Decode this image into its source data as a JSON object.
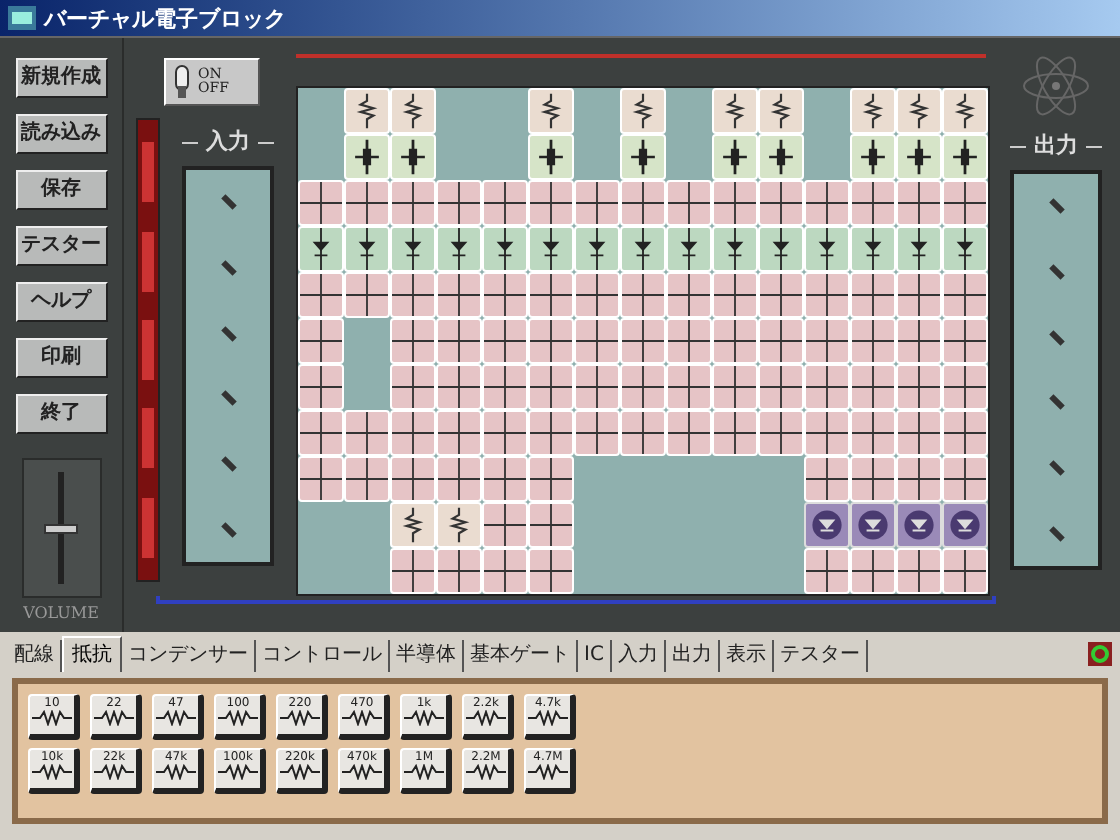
{
  "window": {
    "title": "バーチャル電子ブロック"
  },
  "toolbar": [
    {
      "label": "新規作成"
    },
    {
      "label": "読み込み"
    },
    {
      "label": "保存"
    },
    {
      "label": "テスター"
    },
    {
      "label": "ヘルプ"
    },
    {
      "label": "印刷"
    },
    {
      "label": "終了"
    }
  ],
  "volume": {
    "label": "VOLUME",
    "level": 0.5
  },
  "power_switch": {
    "on_label": "ON",
    "off_label": "OFF",
    "on": false
  },
  "input_panel": {
    "label": "入力"
  },
  "output_panel": {
    "label": "出力"
  },
  "board": {
    "rows": [
      [
        {
          "kind": "empty"
        },
        {
          "kind": "resistor"
        },
        {
          "kind": "resistor"
        },
        {
          "kind": "empty"
        },
        {
          "kind": "empty"
        },
        {
          "kind": "resistor"
        },
        {
          "kind": "empty"
        },
        {
          "kind": "resistor"
        },
        {
          "kind": "empty"
        },
        {
          "kind": "resistor"
        },
        {
          "kind": "resistor"
        },
        {
          "kind": "empty"
        },
        {
          "kind": "resistor"
        },
        {
          "kind": "resistor"
        },
        {
          "kind": "resistor"
        }
      ],
      [
        {
          "kind": "empty"
        },
        {
          "kind": "capacitor"
        },
        {
          "kind": "capacitor"
        },
        {
          "kind": "empty"
        },
        {
          "kind": "empty"
        },
        {
          "kind": "capacitor"
        },
        {
          "kind": "empty"
        },
        {
          "kind": "capacitor"
        },
        {
          "kind": "empty"
        },
        {
          "kind": "capacitor"
        },
        {
          "kind": "capacitor"
        },
        {
          "kind": "empty"
        },
        {
          "kind": "capacitor"
        },
        {
          "kind": "capacitor"
        },
        {
          "kind": "capacitor"
        }
      ],
      [
        {
          "kind": "wire"
        },
        {
          "kind": "wire"
        },
        {
          "kind": "wire"
        },
        {
          "kind": "wire"
        },
        {
          "kind": "wire"
        },
        {
          "kind": "wire"
        },
        {
          "kind": "wire"
        },
        {
          "kind": "wire"
        },
        {
          "kind": "wire"
        },
        {
          "kind": "wire"
        },
        {
          "kind": "wire"
        },
        {
          "kind": "wire"
        },
        {
          "kind": "wire"
        },
        {
          "kind": "wire"
        },
        {
          "kind": "wire"
        }
      ],
      [
        {
          "kind": "diode"
        },
        {
          "kind": "diode"
        },
        {
          "kind": "diode"
        },
        {
          "kind": "diode"
        },
        {
          "kind": "diode"
        },
        {
          "kind": "diode"
        },
        {
          "kind": "diode"
        },
        {
          "kind": "diode"
        },
        {
          "kind": "diode"
        },
        {
          "kind": "diode"
        },
        {
          "kind": "diode"
        },
        {
          "kind": "diode"
        },
        {
          "kind": "diode"
        },
        {
          "kind": "diode"
        },
        {
          "kind": "diode"
        }
      ],
      [
        {
          "kind": "wire"
        },
        {
          "kind": "wire"
        },
        {
          "kind": "wire"
        },
        {
          "kind": "wire"
        },
        {
          "kind": "wire"
        },
        {
          "kind": "wire"
        },
        {
          "kind": "wire"
        },
        {
          "kind": "wire"
        },
        {
          "kind": "wire"
        },
        {
          "kind": "wire"
        },
        {
          "kind": "wire"
        },
        {
          "kind": "wire"
        },
        {
          "kind": "wire"
        },
        {
          "kind": "wire"
        },
        {
          "kind": "wire"
        }
      ],
      [
        {
          "kind": "wire"
        },
        {
          "kind": "empty"
        },
        {
          "kind": "wire"
        },
        {
          "kind": "wire"
        },
        {
          "kind": "wire"
        },
        {
          "kind": "wire"
        },
        {
          "kind": "wire"
        },
        {
          "kind": "wire"
        },
        {
          "kind": "wire"
        },
        {
          "kind": "wire"
        },
        {
          "kind": "wire"
        },
        {
          "kind": "wire"
        },
        {
          "kind": "wire"
        },
        {
          "kind": "wire"
        },
        {
          "kind": "wire"
        }
      ],
      [
        {
          "kind": "wire"
        },
        {
          "kind": "empty"
        },
        {
          "kind": "wire"
        },
        {
          "kind": "wire"
        },
        {
          "kind": "wire"
        },
        {
          "kind": "wire"
        },
        {
          "kind": "wire"
        },
        {
          "kind": "wire"
        },
        {
          "kind": "wire"
        },
        {
          "kind": "wire"
        },
        {
          "kind": "wire"
        },
        {
          "kind": "wire"
        },
        {
          "kind": "wire"
        },
        {
          "kind": "wire"
        },
        {
          "kind": "wire"
        }
      ],
      [
        {
          "kind": "wire"
        },
        {
          "kind": "wire"
        },
        {
          "kind": "wire"
        },
        {
          "kind": "wire"
        },
        {
          "kind": "wire"
        },
        {
          "kind": "wire"
        },
        {
          "kind": "wire"
        },
        {
          "kind": "wire"
        },
        {
          "kind": "wire"
        },
        {
          "kind": "wire"
        },
        {
          "kind": "wire"
        },
        {
          "kind": "wire"
        },
        {
          "kind": "wire"
        },
        {
          "kind": "wire"
        },
        {
          "kind": "wire"
        }
      ],
      [
        {
          "kind": "wire"
        },
        {
          "kind": "wire"
        },
        {
          "kind": "wire"
        },
        {
          "kind": "wire"
        },
        {
          "kind": "wire"
        },
        {
          "kind": "wire"
        },
        {
          "kind": "empty"
        },
        {
          "kind": "empty"
        },
        {
          "kind": "empty"
        },
        {
          "kind": "empty"
        },
        {
          "kind": "empty"
        },
        {
          "kind": "wire"
        },
        {
          "kind": "wire"
        },
        {
          "kind": "wire"
        },
        {
          "kind": "wire"
        }
      ],
      [
        {
          "kind": "empty"
        },
        {
          "kind": "empty"
        },
        {
          "kind": "resistor"
        },
        {
          "kind": "resistor"
        },
        {
          "kind": "wire"
        },
        {
          "kind": "wire"
        },
        {
          "kind": "empty"
        },
        {
          "kind": "empty"
        },
        {
          "kind": "empty"
        },
        {
          "kind": "empty"
        },
        {
          "kind": "empty"
        },
        {
          "kind": "led"
        },
        {
          "kind": "led"
        },
        {
          "kind": "led"
        },
        {
          "kind": "led"
        }
      ],
      [
        {
          "kind": "empty"
        },
        {
          "kind": "empty"
        },
        {
          "kind": "wire"
        },
        {
          "kind": "wire"
        },
        {
          "kind": "wire"
        },
        {
          "kind": "wire"
        },
        {
          "kind": "empty"
        },
        {
          "kind": "empty"
        },
        {
          "kind": "empty"
        },
        {
          "kind": "empty"
        },
        {
          "kind": "empty"
        },
        {
          "kind": "wire"
        },
        {
          "kind": "wire"
        },
        {
          "kind": "wire"
        },
        {
          "kind": "wire"
        }
      ]
    ]
  },
  "tabs": [
    {
      "label": "配線",
      "selected": false
    },
    {
      "label": "抵抗",
      "selected": true
    },
    {
      "label": "コンデンサー",
      "selected": false
    },
    {
      "label": "コントロール",
      "selected": false
    },
    {
      "label": "半導体",
      "selected": false
    },
    {
      "label": "基本ゲート",
      "selected": false
    },
    {
      "label": "IC",
      "selected": false
    },
    {
      "label": "入力",
      "selected": false
    },
    {
      "label": "出力",
      "selected": false
    },
    {
      "label": "表示",
      "selected": false
    },
    {
      "label": "テスター",
      "selected": false
    }
  ],
  "parts": [
    {
      "label": "10"
    },
    {
      "label": "22"
    },
    {
      "label": "47"
    },
    {
      "label": "100"
    },
    {
      "label": "220"
    },
    {
      "label": "470"
    },
    {
      "label": "1k"
    },
    {
      "label": "2.2k"
    },
    {
      "label": "4.7k"
    },
    {
      "label": "10k"
    },
    {
      "label": "22k"
    },
    {
      "label": "47k"
    },
    {
      "label": "100k"
    },
    {
      "label": "220k"
    },
    {
      "label": "470k"
    },
    {
      "label": "1M"
    },
    {
      "label": "2.2M"
    },
    {
      "label": "4.7M"
    }
  ]
}
